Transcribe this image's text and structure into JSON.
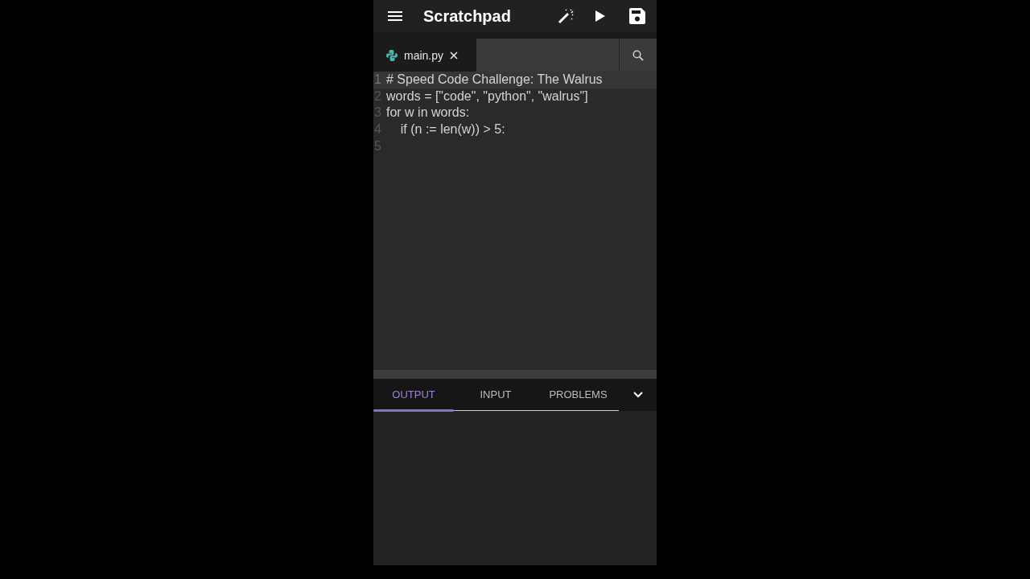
{
  "app_bar": {
    "title": "Scratchpad"
  },
  "file_tabs": [
    {
      "label": "main.py",
      "selected": true
    }
  ],
  "editor": {
    "lines": [
      {
        "number": "1",
        "text": "# Speed Code Challenge: The Walrus",
        "current": true
      },
      {
        "number": "2",
        "text": "words = [\"code\", \"python\", \"walrus\"]",
        "current": false
      },
      {
        "number": "3",
        "text": "for w in words:",
        "current": false
      },
      {
        "number": "4",
        "text": "    if (n := len(w)) > 5:",
        "current": false
      },
      {
        "number": "5",
        "current": false
      }
    ]
  },
  "panel_tabs": [
    {
      "label": "OUTPUT",
      "selected": true
    },
    {
      "label": "INPUT",
      "selected": false
    },
    {
      "label": "PROBLEMS",
      "selected": false
    }
  ]
}
